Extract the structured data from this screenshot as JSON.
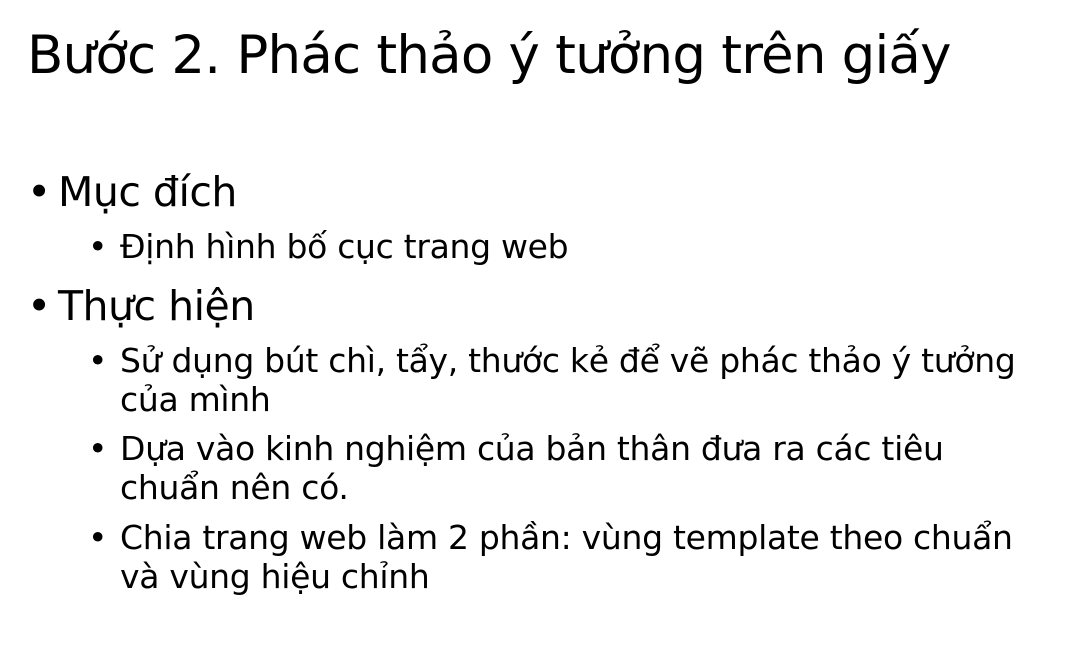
{
  "slide": {
    "title": "Bước 2. Phác thảo ý tưởng trên giấy",
    "bullet_glyph": "•",
    "sections": [
      {
        "heading": "Mục đích",
        "items": [
          "Định hình bố cục trang web"
        ]
      },
      {
        "heading": "Thực hiện",
        "items": [
          "Sử dụng bút chì, tẩy, thước kẻ để vẽ phác thảo ý tưởng của mình",
          "Dựa vào kinh nghiệm của bản thân đưa ra các tiêu chuẩn nên có.",
          "Chia trang web làm 2 phần: vùng template theo chuẩn và vùng hiệu chỉnh"
        ]
      }
    ]
  }
}
